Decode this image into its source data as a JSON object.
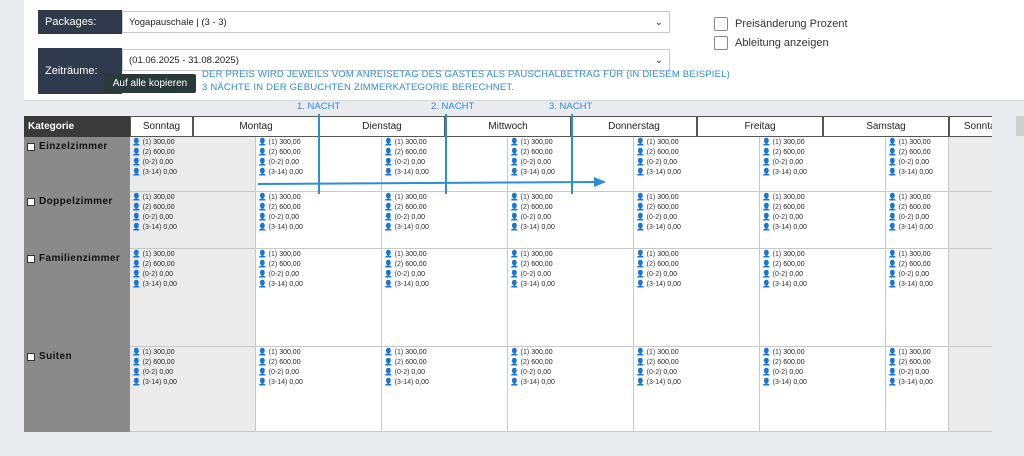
{
  "packages": {
    "label": "Packages:",
    "value": "Yogapauschale | (3 - 3)"
  },
  "zeitraeume": {
    "label": "Zeiträume:",
    "value": "(01.06.2025 - 31.08.2025)"
  },
  "tooltip_button": "Auf alle kopieren",
  "note": [
    "DER PREIS WIRD JEWEILS VOM ANREISETAG DES GASTES ALS PAUSCHALBETRAG FÜR (IN DIESEM BEISPIEL)",
    "3 NÄCHTE IN DER GEBUCHTEN ZIMMERKATEGORIE BERECHNET."
  ],
  "checkboxes": [
    "Preisänderung Prozent",
    "Ableitung anzeigen"
  ],
  "nights": [
    "1. NACHT",
    "2. NACHT",
    "3. NACHT"
  ],
  "table": {
    "kategorie_header": "Kategorie",
    "days": [
      "Sonntag",
      "Montag",
      "Dienstag",
      "Mittwoch",
      "Donnerstag",
      "Freitag",
      "Samstag",
      "Sonntag"
    ],
    "categories": [
      "Einzelzimmer",
      "Doppelzimmer",
      "Familienzimmer",
      "Suiten"
    ],
    "price_lines": [
      {
        "prefix": "(1)",
        "value": "300,00"
      },
      {
        "prefix": "(2)",
        "value": "600,00"
      },
      {
        "prefix": "(0-2)",
        "value": "0,00"
      },
      {
        "prefix": "(3-14)",
        "value": "0,00"
      }
    ]
  },
  "colors": {
    "dark_label": "#2f3b4c",
    "accent_blue": "#2e8cd8",
    "category_bg": "#8a8a8a"
  }
}
